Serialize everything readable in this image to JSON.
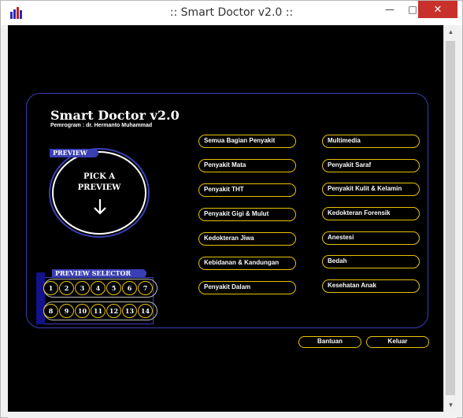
{
  "window": {
    "title": ":: Smart Doctor v2.0 ::",
    "min_label": "—",
    "max_label": "□",
    "close_label": "✕"
  },
  "app": {
    "title": "Smart Doctor v2.0",
    "author": "Pemrogram : dr. Hermanto Muhammad"
  },
  "preview": {
    "tag": "PREVIEW",
    "pick_line1": "PICK A",
    "pick_line2": "PREVIEW"
  },
  "selector": {
    "tag": "PREVIEW SELECTOR",
    "row1": [
      "1",
      "2",
      "3",
      "4",
      "5",
      "6",
      "7"
    ],
    "row2": [
      "8",
      "9",
      "10",
      "11",
      "12",
      "13",
      "14"
    ]
  },
  "menu_left": [
    "Semua Bagian Penyakit",
    "Penyakit Mata",
    "Penyakit THT",
    "Penyakit Gigi & Mulut",
    "Kedokteran Jiwa",
    "Kebidanan & Kandungan",
    "Penyakit Dalam"
  ],
  "menu_right": [
    "Multimedia",
    "Penyakit Saraf",
    "Penyakit Kulit & Kelamin",
    "Kedokteran Forensik",
    "Anestesi",
    "Bedah",
    "Kesehatan Anak"
  ],
  "actions": {
    "help": "Bantuan",
    "exit": "Keluar"
  },
  "colors": {
    "accent_blue": "#3b3fb6",
    "button_gold": "#e8c200",
    "background": "#000000",
    "close_red": "#c7302b"
  },
  "icons": {
    "app": "app-bars-icon",
    "arrow": "arrow-down-icon"
  }
}
